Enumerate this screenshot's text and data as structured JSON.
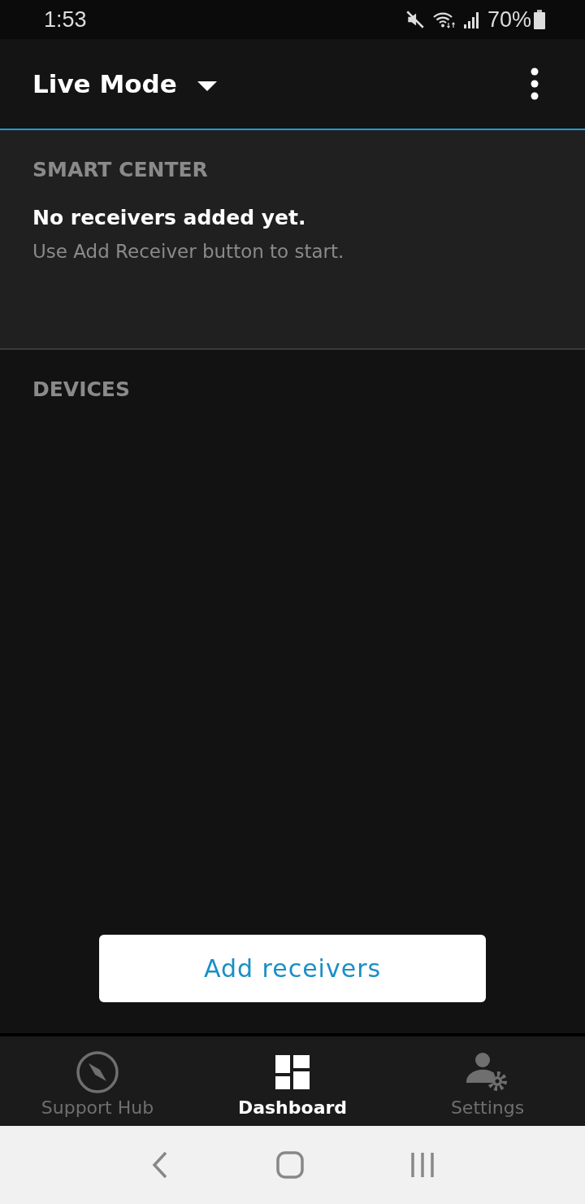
{
  "status_bar": {
    "time": "1:53",
    "battery": "70%"
  },
  "app_bar": {
    "title": "Live Mode"
  },
  "smart_center": {
    "heading": "SMART CENTER",
    "message": "No receivers added yet.",
    "hint": "Use Add Receiver button to start."
  },
  "devices": {
    "heading": "DEVICES"
  },
  "add_button": {
    "label": "Add receivers"
  },
  "bottom_nav": [
    {
      "label": "Support Hub",
      "kind": "compass",
      "selected": false
    },
    {
      "label": "Dashboard",
      "kind": "dashboard",
      "selected": true
    },
    {
      "label": "Settings",
      "kind": "settings",
      "selected": false
    }
  ]
}
